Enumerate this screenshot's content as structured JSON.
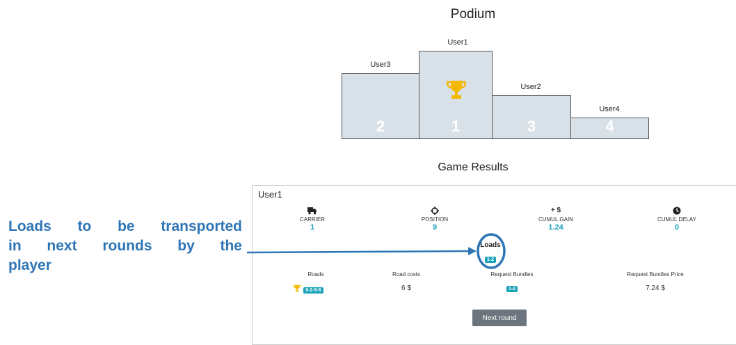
{
  "podium": {
    "title": "Podium",
    "places": [
      {
        "user": "User3",
        "rank": "2"
      },
      {
        "user": "User1",
        "rank": "1"
      },
      {
        "user": "User2",
        "rank": "3"
      },
      {
        "user": "User4",
        "rank": "4"
      }
    ]
  },
  "results": {
    "title": "Game Results",
    "user": "User1",
    "stats": [
      {
        "icon": "truck-icon",
        "label": "CARRIER",
        "value": "1"
      },
      {
        "icon": "crosshair-icon",
        "label": "POSITION",
        "value": "9"
      },
      {
        "icon": "dollar-icon",
        "label": "CUMUL GAIN",
        "value": "1.24",
        "icon_text": "+ $"
      },
      {
        "icon": "clock-icon",
        "label": "CUMUL DELAY",
        "value": "0"
      }
    ],
    "loads": {
      "label": "Loads",
      "badge": "1-2"
    },
    "columns": {
      "roads": "Roads",
      "road_costs": "Road costs",
      "request_bundles": "Request Bundles",
      "request_bundles_price": "Request Bundles Price"
    },
    "row": {
      "roads_badge": "9-2-9-6",
      "road_costs": "6 $",
      "request_bundles_badge": "1-2",
      "request_bundles_price": "7.24 $"
    },
    "next_button": "Next round"
  },
  "annotation": {
    "line1": "Loads to be transported",
    "line2": "in next rounds by the",
    "line3": "player"
  },
  "colors": {
    "accent": "#17a2b8",
    "annotation": "#2e75b6",
    "podium_fill": "#d9e1e8",
    "trophy": "#f5b800",
    "button": "#6c757d"
  }
}
